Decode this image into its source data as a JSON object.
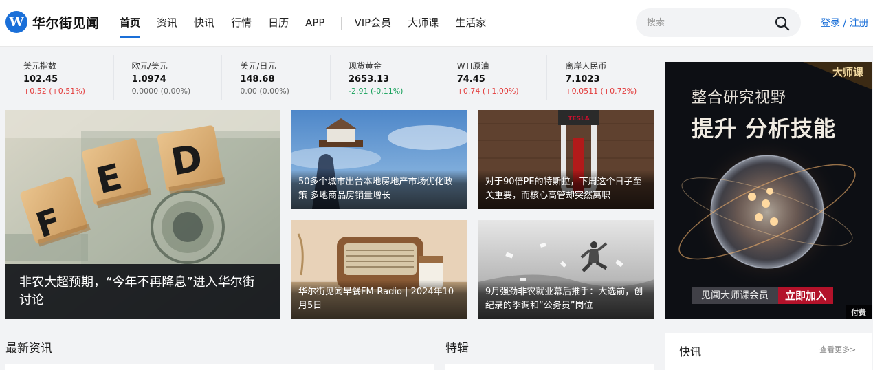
{
  "header": {
    "logo_mark": "W",
    "logo_text": "华尔街见闻",
    "nav": [
      {
        "label": "首页",
        "active": true
      },
      {
        "label": "资讯"
      },
      {
        "label": "快讯"
      },
      {
        "label": "行情"
      },
      {
        "label": "日历"
      },
      {
        "label": "APP"
      }
    ],
    "nav_secondary": [
      {
        "label": "VIP会员"
      },
      {
        "label": "大师课"
      },
      {
        "label": "生活家"
      }
    ],
    "search_placeholder": "搜索",
    "login_label": "登录 / 注册"
  },
  "tickers": [
    {
      "name": "美元指数",
      "value": "102.45",
      "change": "+0.52 (+0.51%)",
      "dir": "up"
    },
    {
      "name": "欧元/美元",
      "value": "1.0974",
      "change": "0.0000 (0.00%)",
      "dir": "flat"
    },
    {
      "name": "美元/日元",
      "value": "148.68",
      "change": "0.00 (0.00%)",
      "dir": "flat"
    },
    {
      "name": "现货黄金",
      "value": "2653.13",
      "change": "-2.91 (-0.11%)",
      "dir": "down"
    },
    {
      "name": "WTI原油",
      "value": "74.45",
      "change": "+0.74 (+1.00%)",
      "dir": "up"
    },
    {
      "name": "离岸人民币",
      "value": "7.1023",
      "change": "+0.0511 (+0.72%)",
      "dir": "up"
    }
  ],
  "cards": {
    "main": {
      "title": "非农大超预期，“今年不再降息”进入华尔街讨论",
      "block_letters": [
        "F",
        "E",
        "D"
      ]
    },
    "c1": {
      "title": "50多个城市出台本地房地产市场优化政策 多地商品房销量增长"
    },
    "c2": {
      "title": "对于90倍PE的特斯拉，下周这个日子至关重要，而核心高管却突然离职",
      "sign": "TESLA"
    },
    "c3": {
      "title": "华尔街见闻早餐FM-Radio | 2024年10月5日"
    },
    "c4": {
      "title": "9月强劲非农就业幕后推手：大选前，创纪录的季调和“公务员”岗位"
    }
  },
  "ad": {
    "brand": "大师课",
    "line1": "整合研究视野",
    "line2": "提升 分析技能",
    "cta_left": "见闻大师课会员",
    "cta_right": "立即加入",
    "tag": "付费"
  },
  "sections": {
    "latest": "最新资讯",
    "special": "特辑",
    "flash": "快讯",
    "flash_more": "查看更多>"
  },
  "colors": {
    "brand_blue": "#1a6fd8",
    "up_red": "#e33b3b",
    "down_green": "#16a05a",
    "ad_red": "#b3122a"
  }
}
